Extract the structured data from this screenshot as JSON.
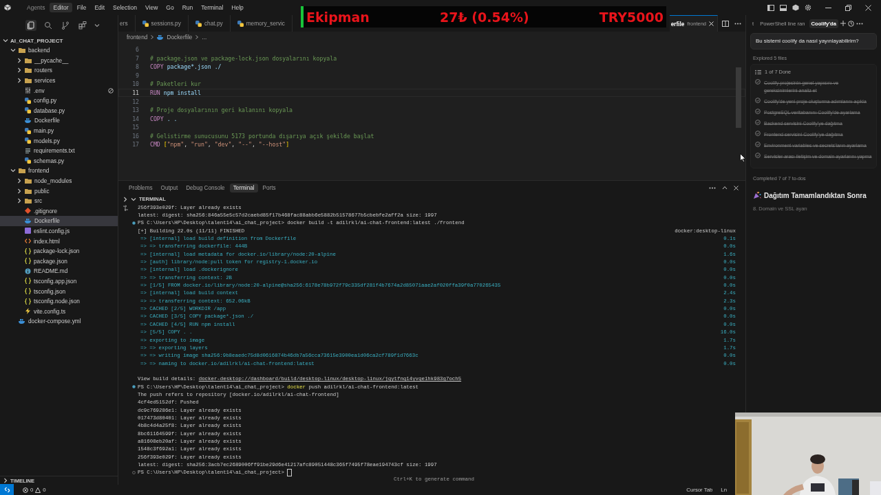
{
  "menu": [
    {
      "label": "Agents",
      "selected": false
    },
    {
      "label": "Editor",
      "selected": true
    },
    {
      "label": "File",
      "selected": false
    },
    {
      "label": "Edit",
      "selected": false
    },
    {
      "label": "Selection",
      "selected": false
    },
    {
      "label": "View",
      "selected": false
    },
    {
      "label": "Go",
      "selected": false
    },
    {
      "label": "Run",
      "selected": false
    },
    {
      "label": "Terminal",
      "selected": false
    },
    {
      "label": "Help",
      "selected": false
    }
  ],
  "ticker": {
    "label": "Ekipman",
    "change": "27₺ (0.54%)",
    "amount": "TRY5000"
  },
  "sidebar": {
    "views": [
      {
        "kind": "files",
        "selected": true
      },
      {
        "kind": "search",
        "selected": false
      },
      {
        "kind": "source-control",
        "selected": false
      },
      {
        "kind": "extensions",
        "selected": false
      }
    ],
    "project": {
      "title": "AI_CHAT_PROJECT",
      "expanded": true
    },
    "tree": [
      {
        "name": "backend",
        "kind": "folder",
        "expanded": true,
        "selected": false,
        "children": [
          {
            "name": "__pycache__",
            "kind": "folder",
            "expanded": false,
            "selected": false
          },
          {
            "name": "routers",
            "kind": "folder",
            "expanded": false,
            "selected": false
          },
          {
            "name": "services",
            "kind": "folder",
            "expanded": false,
            "selected": false
          },
          {
            "name": ".env",
            "kind": "env",
            "selected": false
          },
          {
            "name": "config.py",
            "kind": "python",
            "selected": false
          },
          {
            "name": "database.py",
            "kind": "python",
            "selected": false
          },
          {
            "name": "Dockerfile",
            "kind": "docker",
            "selected": false
          },
          {
            "name": "main.py",
            "kind": "python",
            "selected": false
          },
          {
            "name": "models.py",
            "kind": "python",
            "selected": false
          },
          {
            "name": "requirements.txt",
            "kind": "text",
            "selected": false
          },
          {
            "name": "schemas.py",
            "kind": "python",
            "selected": false
          }
        ]
      },
      {
        "name": "frontend",
        "kind": "folder",
        "expanded": true,
        "selected": false,
        "children": [
          {
            "name": "node_modules",
            "kind": "folder",
            "expanded": false,
            "selected": false
          },
          {
            "name": "public",
            "kind": "folder",
            "expanded": false,
            "selected": false
          },
          {
            "name": "src",
            "kind": "folder",
            "expanded": false,
            "selected": false
          },
          {
            "name": ".gitignore",
            "kind": "git",
            "selected": false
          },
          {
            "name": "Dockerfile",
            "kind": "docker",
            "selected": true
          },
          {
            "name": "eslint.config.js",
            "kind": "js",
            "selected": false
          },
          {
            "name": "index.html",
            "kind": "html",
            "selected": false
          },
          {
            "name": "package-lock.json",
            "kind": "json",
            "selected": false
          },
          {
            "name": "package.json",
            "kind": "json",
            "selected": false
          },
          {
            "name": "README.md",
            "kind": "md",
            "selected": false
          },
          {
            "name": "tsconfig.app.json",
            "kind": "json",
            "selected": false
          },
          {
            "name": "tsconfig.json",
            "kind": "json",
            "selected": false
          },
          {
            "name": "tsconfig.node.json",
            "kind": "json",
            "selected": false
          },
          {
            "name": "vite.config.ts",
            "kind": "ts",
            "selected": false
          }
        ]
      },
      {
        "name": "docker-compose.yml",
        "kind": "yaml",
        "selected": false
      }
    ],
    "timeline": {
      "title": "TIMELINE",
      "expanded": false
    }
  },
  "editor": {
    "tabs": [
      {
        "label": "ers",
        "kind": "plain",
        "selected": false
      },
      {
        "label": "sessions.py",
        "kind": "python",
        "selected": false
      },
      {
        "label": "chat.py",
        "kind": "python",
        "selected": false
      },
      {
        "label": "memory_servic",
        "kind": "python",
        "selected": false
      },
      {
        "label": "erfile",
        "detail": "frontend",
        "kind": "plain",
        "selected": true
      }
    ],
    "breadcrumb": [
      "frontend",
      "Dockerfile",
      "..."
    ],
    "lines": [
      {
        "number": "6",
        "current": false
      },
      {
        "number": "7",
        "current": false,
        "tokens": [
          {
            "text": "# package.json ve package-lock.json dosyalarını kopyala",
            "kind": "comment"
          }
        ]
      },
      {
        "number": "8",
        "current": false,
        "tokens": [
          {
            "text": "COPY",
            "kind": "keyword"
          },
          {
            "text": " package*.json ./",
            "kind": "text"
          }
        ]
      },
      {
        "number": "9",
        "current": false
      },
      {
        "number": "10",
        "current": false,
        "tokens": [
          {
            "text": "# Paketleri kur",
            "kind": "comment"
          }
        ]
      },
      {
        "number": "11",
        "current": true,
        "tokens": [
          {
            "text": "RUN",
            "kind": "keyword"
          },
          {
            "text": " npm install",
            "kind": "text"
          }
        ]
      },
      {
        "number": "12",
        "current": false
      },
      {
        "number": "13",
        "current": false,
        "tokens": [
          {
            "text": "# Proje dosyalarının geri kalanını kopyala",
            "kind": "comment"
          }
        ]
      },
      {
        "number": "14",
        "current": false,
        "tokens": [
          {
            "text": "COPY",
            "kind": "keyword"
          },
          {
            "text": " . .",
            "kind": "text"
          }
        ]
      },
      {
        "number": "15",
        "current": false
      },
      {
        "number": "16",
        "current": false,
        "tokens": [
          {
            "text": "# Gelistirme sunucusunu 5173 portunda dışarıya açık şekilde başlat",
            "kind": "comment"
          }
        ]
      },
      {
        "number": "17",
        "current": false,
        "tokens": [
          {
            "text": "CMD",
            "kind": "keyword"
          },
          {
            "text": " [",
            "kind": "bracket"
          },
          {
            "text": "\"npm\"",
            "kind": "string"
          },
          {
            "text": ", ",
            "kind": "punct"
          },
          {
            "text": "\"run\"",
            "kind": "string"
          },
          {
            "text": ", ",
            "kind": "punct"
          },
          {
            "text": "\"dev\"",
            "kind": "string"
          },
          {
            "text": ", ",
            "kind": "punct"
          },
          {
            "text": "\"--\"",
            "kind": "string"
          },
          {
            "text": ", ",
            "kind": "punct"
          },
          {
            "text": "\"--host\"",
            "kind": "string"
          },
          {
            "text": "]",
            "kind": "bracket"
          }
        ]
      }
    ]
  },
  "panel": {
    "tabs": [
      {
        "label": "Problems",
        "selected": false
      },
      {
        "label": "Output",
        "selected": false
      },
      {
        "label": "Debug Console",
        "selected": false
      },
      {
        "label": "Terminal",
        "selected": true
      },
      {
        "label": "Ports",
        "selected": false
      }
    ],
    "section": {
      "title": "TERMINAL",
      "expanded": true
    },
    "hint": "Ctrl+K to generate command",
    "terminal": [
      {
        "kind": "output",
        "text": "256f393e029f: Layer already exists"
      },
      {
        "kind": "output",
        "text": "latest: digest: sha256:846a55e5c57d2caebd85f17b468fac88abb6e5882b51578677b5cbebfe2aff2a size: 1997"
      },
      {
        "kind": "prompt",
        "prompt": "PS C:\\Users\\HP\\Desktop\\talent14\\ai_chat_project>",
        "program": "docker",
        "args": "build -t adilrkl/ai-chat-frontend:latest ./frontend",
        "highlighted": false,
        "finished": true,
        "cursor": false
      },
      {
        "kind": "build",
        "text": "[+] Building 22.0s (11/11) FINISHED",
        "right": "docker:desktop-linux"
      },
      {
        "kind": "step",
        "text": "=> [internal] load build definition from Dockerfile",
        "time": "0.1s"
      },
      {
        "kind": "step",
        "text": "=> => transferring dockerfile: 444B",
        "time": "0.0s"
      },
      {
        "kind": "step",
        "text": "=> [internal] load metadata for docker.io/library/node:20-alpine",
        "time": "1.6s"
      },
      {
        "kind": "step",
        "text": "=> [auth] library/node:pull token for registry-1.docker.io",
        "time": "0.0s"
      },
      {
        "kind": "step",
        "text": "=> [internal] load .dockerignore",
        "time": "0.0s"
      },
      {
        "kind": "step",
        "text": "=> => transferring context: 2B",
        "time": "0.0s"
      },
      {
        "kind": "step",
        "text": "=> [1/5] FROM docker.io/library/node:20-alpine@sha256:6178e78b972f79c335df281f4b7674a2d85071aae2af020ffa39f0a770265435",
        "time": "0.0s"
      },
      {
        "kind": "step",
        "text": "=> [internal] load build context",
        "time": "2.4s"
      },
      {
        "kind": "step",
        "text": "=> => transferring context: 652.06kB",
        "time": "2.3s"
      },
      {
        "kind": "step",
        "text": "=> CACHED [2/5] WORKDIR /app",
        "time": "0.0s"
      },
      {
        "kind": "step",
        "text": "=> CACHED [3/5] COPY package*.json ./",
        "time": "0.0s"
      },
      {
        "kind": "step",
        "text": "=> CACHED [4/5] RUN npm install",
        "time": "0.0s"
      },
      {
        "kind": "step",
        "text": "=> [5/5] COPY . .",
        "time": "16.0s"
      },
      {
        "kind": "step",
        "text": "=> exporting to image",
        "time": "1.7s"
      },
      {
        "kind": "step",
        "text": "=> => exporting layers",
        "time": "1.7s"
      },
      {
        "kind": "step",
        "text": "=> => writing image sha256:9b8eaedc75d8d0616874b46db7a56cca73615e3900ea1d06ca2cf789f1d7663c",
        "time": "0.0s"
      },
      {
        "kind": "step",
        "text": "=> => naming to docker.io/adilrkl/ai-chat-frontend:latest",
        "time": "0.0s"
      },
      {
        "kind": "blank"
      },
      {
        "kind": "link",
        "text": "View build details:",
        "link": "docker-desktop://dashboard/build/desktop-linux/desktop-linux/jqytfnq14yvqe1hk983g7och5"
      },
      {
        "kind": "prompt",
        "prompt": "PS C:\\Users\\HP\\Desktop\\talent14\\ai_chat_project>",
        "program": "docker",
        "args": "push adilrkl/ai-chat-frontend:latest",
        "highlighted": true,
        "finished": true,
        "cursor": false
      },
      {
        "kind": "output",
        "text": "The push refers to repository [docker.io/adilrkl/ai-chat-frontend]"
      },
      {
        "kind": "output",
        "text": "4cf4ed5152df: Pushed"
      },
      {
        "kind": "output",
        "text": "dc9c769286e1: Layer already exists"
      },
      {
        "kind": "output",
        "text": "017473d80401: Layer already exists"
      },
      {
        "kind": "output",
        "text": "4b8c4d4a25f8: Layer already exists"
      },
      {
        "kind": "output",
        "text": "8bc61164599f: Layer already exists"
      },
      {
        "kind": "output",
        "text": "a81608eb20af: Layer already exists"
      },
      {
        "kind": "output",
        "text": "1548c3f692a1: Layer already exists"
      },
      {
        "kind": "output",
        "text": "256f393e029f: Layer already exists"
      },
      {
        "kind": "output",
        "text": "latest: digest: sha256:3acb7ec2689006ff91be29d6e41217afc89051448c365f7495f78eae194743cf size: 1997"
      },
      {
        "kind": "prompt",
        "prompt": "PS C:\\Users\\HP\\Desktop\\talent14\\ai_chat_project>",
        "finished": false,
        "cursor": true
      }
    ]
  },
  "chat": {
    "tabs": [
      {
        "label": "t",
        "selected": false
      },
      {
        "label": "PowerShell line ran",
        "selected": false
      },
      {
        "label": "Coolify'da",
        "selected": true
      }
    ],
    "message": "Bu sistemi coolify da nasıl yayınlayabilirim?",
    "explored": "Explored 5 files",
    "todo_header": "1 of 7 Done",
    "todos": [
      {
        "text": "Coolify projesinin genel yapısını ve gereksinimlerini analiz et",
        "done": true
      },
      {
        "text": "Coolify'de yeni proje oluşturma adımlarını açıkla",
        "done": true
      },
      {
        "text": "PostgreSQL veritabanını Coolify'de ayarlama",
        "done": true
      },
      {
        "text": "Backend servisini Coolify'ye dağıtma",
        "done": true
      },
      {
        "text": "Frontend servisini Coolify'ye dağıtma",
        "done": true
      },
      {
        "text": "Environment variables ve secrets'ların ayarlama",
        "done": true
      },
      {
        "text": "Servisler arası iletişim ve domain ayarlarını yapma",
        "done": true
      }
    ],
    "completed": "Completed 7 of 7 to-dos",
    "heading": "Dağıtım Tamamlandıktan Sonra",
    "streaming": "8. Domain ve SSL ayarı"
  },
  "status_bar": {
    "errors": "0",
    "warnings": "0",
    "right": [
      "Cursor Tab",
      "Ln"
    ]
  }
}
